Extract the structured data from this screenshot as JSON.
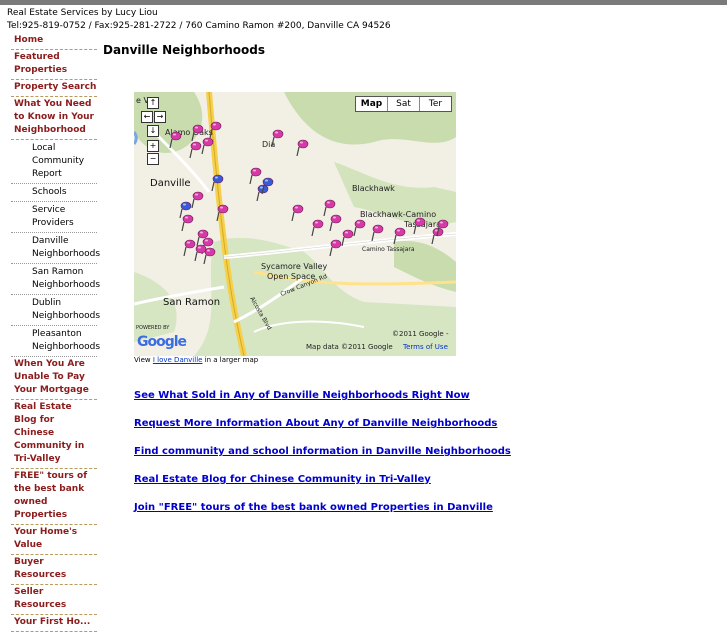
{
  "header": {
    "line1": "Real Estate Services by Lucy Liou",
    "line2": "Tel:925-819-0752 / Fax:925-281-2722 / 760 Camino Ramon #200, Danville CA 94526"
  },
  "nav": {
    "home": "Home",
    "featured": "Featured Properties",
    "search": "Property Search",
    "need_to_know": "What You Need to Know in Your Neighborhood",
    "sub": [
      "Local Community Report",
      "Schools",
      "Service Providers",
      "Danville Neighborhoods",
      "San Ramon Neighborhoods",
      "Dublin Neighborhoods",
      "Pleasanton Neighborhoods"
    ],
    "unable_to_pay": "When You Are Unable To Pay Your Mortgage",
    "blog": "Real Estate Blog for Chinese Community in Tri-Valley",
    "free_tours": "FREE\" tours of the best bank owned Properties",
    "home_value": "Your Home's Value",
    "buyer": "Buyer Resources",
    "seller": "Seller Resources",
    "partial": "Your First Ho..."
  },
  "page": {
    "title": "Danville Neighborhoods"
  },
  "map": {
    "type_buttons": [
      "Map",
      "Sat",
      "Ter"
    ],
    "labels": {
      "alamo_oaks": "Alamo Oaks",
      "danville": "Danville",
      "blackhawk": "Blackhawk",
      "blackhawk_camino": "Blackhawk-Camino",
      "tassajara": "Tassajara",
      "camino_tassajara": "Camino Tassajara",
      "sycamore": "Sycamore Valley",
      "open_space": "Open Space",
      "san_ramon": "San Ramon",
      "crow_canyon": "Crow Canyon Rd",
      "alcosta": "Alcosta Blvd",
      "dia": "Dia",
      "valley": "e Va",
      "google": "Google",
      "powered_by": "POWERED BY",
      "copyright": "©2011 Google -",
      "map_data": "Map data ©2011 Google",
      "terms": "Terms of Use"
    },
    "caption_prefix": "View",
    "caption_link": "I love Danville",
    "caption_suffix": "in a larger map"
  },
  "links": [
    "See What Sold in Any of Danville Neighborhoods Right Now",
    "Request More Information About Any of Danville Neighborhoods",
    "Find community and school information in Danville Neighborhoods",
    "Real Estate Blog for Chinese Community in Tri-Valley",
    "Join \"FREE\" tours of the best bank owned Properties in Danville"
  ],
  "colors": {
    "nav": "#8b1c1c",
    "link": "#0000cc",
    "pin_pink": "#d63aa6",
    "pin_blue": "#3a5bd6",
    "road": "#f5d04a"
  }
}
